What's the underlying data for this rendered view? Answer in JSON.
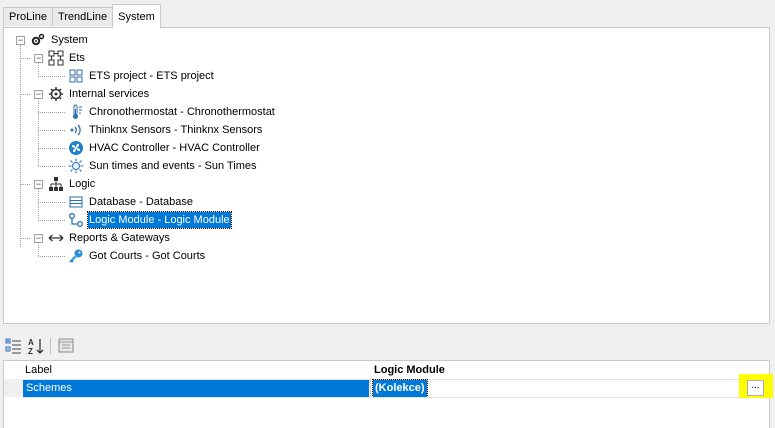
{
  "tabs": [
    {
      "label": "ProLine"
    },
    {
      "label": "TrendLine"
    },
    {
      "label": "System",
      "active": true
    }
  ],
  "tree": {
    "root": {
      "label": "System",
      "icon": "gears-icon"
    },
    "groups": [
      {
        "label": "Ets",
        "icon": "network-nodes-icon",
        "children": [
          {
            "label": "ETS project - ETS project",
            "icon": "grid-nodes-icon"
          }
        ]
      },
      {
        "label": "Internal services",
        "icon": "gear-icon",
        "children": [
          {
            "label": "Chronothermostat - Chronothermostat",
            "icon": "thermometer-icon"
          },
          {
            "label": "Thinknx Sensors - Thinknx Sensors",
            "icon": "sensor-waves-icon"
          },
          {
            "label": "HVAC Controller - HVAC Controller",
            "icon": "fan-icon"
          },
          {
            "label": "Sun times and events - Sun Times",
            "icon": "sun-icon"
          }
        ]
      },
      {
        "label": "Logic",
        "icon": "hierarchy-icon",
        "children": [
          {
            "label": "Database - Database",
            "icon": "database-icon"
          },
          {
            "label": "Logic Module - Logic Module",
            "icon": "logic-nodes-icon",
            "selected": true
          }
        ]
      },
      {
        "label": "Reports & Gateways",
        "icon": "double-arrow-icon",
        "children": [
          {
            "label": "Got Courts - Got Courts",
            "icon": "key-icon"
          }
        ]
      }
    ]
  },
  "toolbar": {
    "categorized": "categorized-icon",
    "alphabetical": "sort-az-icon",
    "pages": "property-pages-icon"
  },
  "property_grid": {
    "header_label": "Label",
    "header_value": "Logic Module",
    "row": {
      "label": "Schemes",
      "value": "(Kolekce)",
      "button": "..."
    }
  },
  "colors": {
    "selection": "#0078d7",
    "highlight": "#ffff00"
  }
}
